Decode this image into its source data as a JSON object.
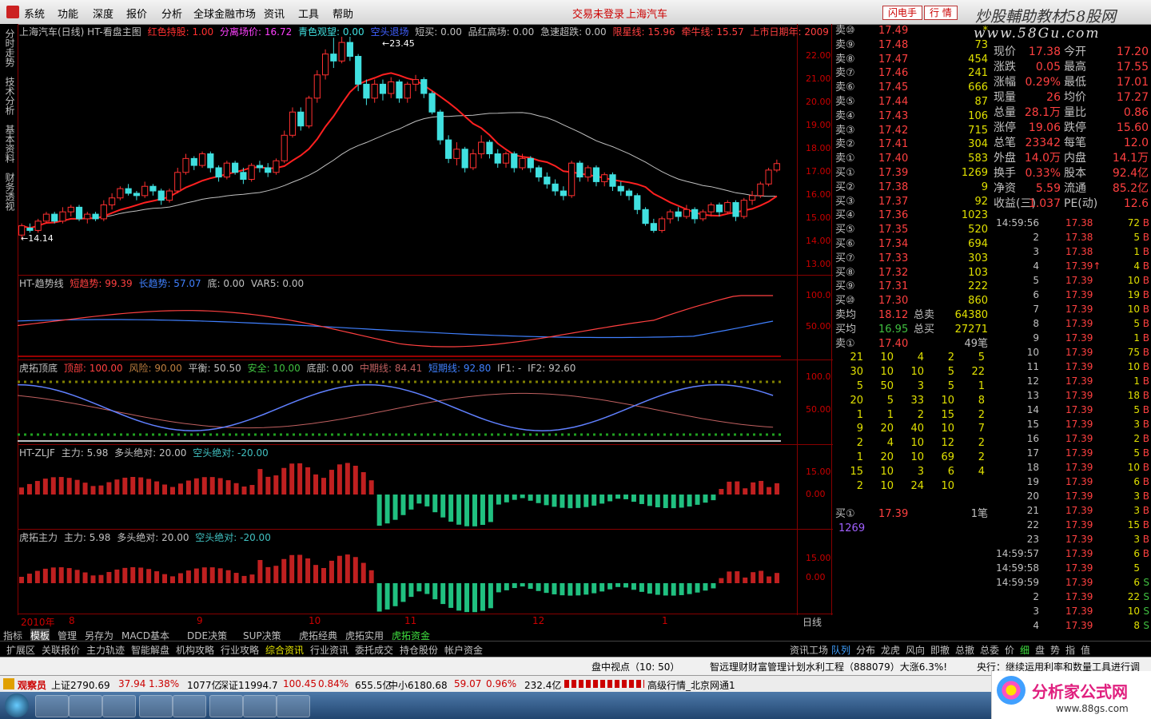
{
  "menu": [
    "系统",
    "功能",
    "深度",
    "报价",
    "分析",
    "全球金融市场",
    "资讯",
    "工具",
    "帮助"
  ],
  "header": {
    "login_status": "交易未登录",
    "stock_title": "上海汽车",
    "btn_flash": "闪电手",
    "btn_quote": "行 情"
  },
  "watermark": {
    "line1": "炒股輔助教材58股网",
    "line2": "www.58Gu.com"
  },
  "left_tabs": [
    "分时走势",
    "技术分析",
    "基本资料",
    "财务透视"
  ],
  "main_chart": {
    "title": "上海汽车(日线) HT-看盘主图",
    "legend": [
      {
        "label": "红色持股: 1.00",
        "color": "#ff3030"
      },
      {
        "label": "分离场价: 16.72",
        "color": "#ff40ff"
      },
      {
        "label": "青色观望: 0.00",
        "color": "#40e0e0"
      },
      {
        "label": "空头退场",
        "color": "#4060ff"
      },
      {
        "label": "短买: 0.00",
        "color": "#c0c0c0"
      },
      {
        "label": "品红高场: 0.00",
        "color": "#c0c0c0"
      },
      {
        "label": "急速超跌: 0.00",
        "color": "#c0c0c0"
      },
      {
        "label": "限星线: 15.96",
        "color": "#ff4040"
      },
      {
        "label": "牵牛线: 15.57",
        "color": "#ff4040"
      },
      {
        "label": "上市日期年: 2009",
        "color": "#ff4040"
      }
    ],
    "y_ticks": [
      "22.00",
      "21.00",
      "20.00",
      "19.00",
      "18.00",
      "17.00",
      "16.00",
      "15.00",
      "14.00",
      "13.00"
    ],
    "annotations": {
      "low": "14.14",
      "high": "23.45"
    }
  },
  "chart_data": {
    "type": "candlestick",
    "ylim": [
      13,
      22.5
    ],
    "candles": [
      {
        "o": 14.3,
        "c": 14.7,
        "h": 14.8,
        "l": 14.1
      },
      {
        "o": 14.6,
        "c": 14.5,
        "h": 14.8,
        "l": 14.4
      },
      {
        "o": 14.5,
        "c": 14.9,
        "h": 15.0,
        "l": 14.4
      },
      {
        "o": 14.9,
        "c": 15.2,
        "h": 15.3,
        "l": 14.8
      },
      {
        "o": 15.2,
        "c": 14.9,
        "h": 15.3,
        "l": 14.8
      },
      {
        "o": 14.9,
        "c": 15.3,
        "h": 15.5,
        "l": 14.8
      },
      {
        "o": 15.3,
        "c": 15.5,
        "h": 15.6,
        "l": 15.1
      },
      {
        "o": 15.5,
        "c": 15.0,
        "h": 15.6,
        "l": 14.9
      },
      {
        "o": 15.0,
        "c": 15.2,
        "h": 15.3,
        "l": 14.8
      },
      {
        "o": 15.2,
        "c": 15.0,
        "h": 15.3,
        "l": 14.9
      },
      {
        "o": 15.0,
        "c": 15.6,
        "h": 15.8,
        "l": 14.9
      },
      {
        "o": 15.6,
        "c": 15.9,
        "h": 16.1,
        "l": 15.4
      },
      {
        "o": 15.9,
        "c": 16.3,
        "h": 16.4,
        "l": 15.8
      },
      {
        "o": 16.3,
        "c": 16.1,
        "h": 16.5,
        "l": 16.0
      },
      {
        "o": 16.1,
        "c": 16.0,
        "h": 16.2,
        "l": 15.8
      },
      {
        "o": 16.0,
        "c": 16.4,
        "h": 16.6,
        "l": 15.9
      },
      {
        "o": 16.4,
        "c": 16.2,
        "h": 16.5,
        "l": 16.0
      },
      {
        "o": 16.2,
        "c": 15.8,
        "h": 16.3,
        "l": 15.6
      },
      {
        "o": 15.8,
        "c": 16.2,
        "h": 16.3,
        "l": 15.7
      },
      {
        "o": 16.2,
        "c": 17.0,
        "h": 17.2,
        "l": 16.1
      },
      {
        "o": 17.0,
        "c": 17.6,
        "h": 17.8,
        "l": 16.9
      },
      {
        "o": 17.6,
        "c": 17.3,
        "h": 17.7,
        "l": 17.1
      },
      {
        "o": 17.3,
        "c": 17.8,
        "h": 17.9,
        "l": 17.2
      },
      {
        "o": 17.8,
        "c": 17.2,
        "h": 17.9,
        "l": 17.0
      },
      {
        "o": 17.2,
        "c": 16.8,
        "h": 17.3,
        "l": 16.6
      },
      {
        "o": 16.8,
        "c": 17.4,
        "h": 17.5,
        "l": 16.7
      },
      {
        "o": 17.4,
        "c": 17.0,
        "h": 17.5,
        "l": 16.9
      },
      {
        "o": 17.0,
        "c": 16.7,
        "h": 17.2,
        "l": 16.5
      },
      {
        "o": 16.7,
        "c": 17.3,
        "h": 17.4,
        "l": 16.6
      },
      {
        "o": 17.3,
        "c": 17.2,
        "h": 17.5,
        "l": 17.0
      },
      {
        "o": 17.2,
        "c": 17.0,
        "h": 17.4,
        "l": 16.8
      },
      {
        "o": 17.0,
        "c": 17.5,
        "h": 17.6,
        "l": 16.9
      },
      {
        "o": 17.5,
        "c": 18.6,
        "h": 18.8,
        "l": 17.4
      },
      {
        "o": 18.6,
        "c": 19.6,
        "h": 19.8,
        "l": 18.5
      },
      {
        "o": 19.6,
        "c": 19.0,
        "h": 19.8,
        "l": 18.8
      },
      {
        "o": 19.0,
        "c": 20.2,
        "h": 20.3,
        "l": 18.9
      },
      {
        "o": 20.2,
        "c": 21.2,
        "h": 21.4,
        "l": 20.0
      },
      {
        "o": 21.2,
        "c": 22.1,
        "h": 22.3,
        "l": 21.0
      },
      {
        "o": 22.1,
        "c": 21.8,
        "h": 22.8,
        "l": 21.5
      },
      {
        "o": 21.8,
        "c": 22.6,
        "h": 23.45,
        "l": 21.7
      },
      {
        "o": 22.6,
        "c": 22.0,
        "h": 23.0,
        "l": 21.8
      },
      {
        "o": 22.0,
        "c": 20.8,
        "h": 22.1,
        "l": 20.5
      },
      {
        "o": 20.8,
        "c": 20.2,
        "h": 21.0,
        "l": 19.9
      },
      {
        "o": 20.2,
        "c": 20.8,
        "h": 21.0,
        "l": 20.0
      },
      {
        "o": 20.8,
        "c": 20.4,
        "h": 21.0,
        "l": 20.1
      },
      {
        "o": 20.4,
        "c": 20.9,
        "h": 21.1,
        "l": 20.2
      },
      {
        "o": 20.9,
        "c": 20.2,
        "h": 21.0,
        "l": 20.0
      },
      {
        "o": 20.2,
        "c": 20.8,
        "h": 20.9,
        "l": 20.0
      },
      {
        "o": 20.8,
        "c": 21.0,
        "h": 21.2,
        "l": 20.5
      },
      {
        "o": 21.0,
        "c": 20.4,
        "h": 21.1,
        "l": 20.2
      },
      {
        "o": 20.4,
        "c": 19.6,
        "h": 20.5,
        "l": 19.5
      },
      {
        "o": 19.6,
        "c": 18.4,
        "h": 19.7,
        "l": 18.2
      },
      {
        "o": 18.4,
        "c": 17.6,
        "h": 18.6,
        "l": 17.4
      },
      {
        "o": 17.6,
        "c": 18.0,
        "h": 18.3,
        "l": 17.3
      },
      {
        "o": 18.0,
        "c": 17.2,
        "h": 18.1,
        "l": 17.0
      },
      {
        "o": 17.2,
        "c": 17.8,
        "h": 18.0,
        "l": 17.1
      },
      {
        "o": 17.8,
        "c": 18.3,
        "h": 18.6,
        "l": 17.6
      },
      {
        "o": 18.3,
        "c": 17.8,
        "h": 18.4,
        "l": 17.6
      },
      {
        "o": 17.8,
        "c": 17.4,
        "h": 18.0,
        "l": 17.2
      },
      {
        "o": 17.4,
        "c": 17.8,
        "h": 17.9,
        "l": 17.2
      },
      {
        "o": 17.8,
        "c": 17.2,
        "h": 17.9,
        "l": 17.0
      },
      {
        "o": 17.2,
        "c": 17.6,
        "h": 17.8,
        "l": 17.1
      },
      {
        "o": 17.6,
        "c": 17.2,
        "h": 17.7,
        "l": 17.0
      },
      {
        "o": 17.2,
        "c": 16.8,
        "h": 17.3,
        "l": 16.6
      },
      {
        "o": 16.8,
        "c": 16.5,
        "h": 17.0,
        "l": 16.3
      },
      {
        "o": 16.5,
        "c": 16.2,
        "h": 16.7,
        "l": 16.0
      },
      {
        "o": 16.2,
        "c": 16.0,
        "h": 16.4,
        "l": 15.8
      },
      {
        "o": 16.0,
        "c": 17.4,
        "h": 17.5,
        "l": 15.9
      },
      {
        "o": 17.4,
        "c": 16.8,
        "h": 17.5,
        "l": 16.6
      },
      {
        "o": 16.8,
        "c": 17.2,
        "h": 17.3,
        "l": 16.6
      },
      {
        "o": 17.2,
        "c": 16.6,
        "h": 17.3,
        "l": 16.4
      },
      {
        "o": 16.6,
        "c": 16.9,
        "h": 17.0,
        "l": 16.4
      },
      {
        "o": 16.9,
        "c": 16.4,
        "h": 17.0,
        "l": 16.2
      },
      {
        "o": 16.4,
        "c": 16.2,
        "h": 16.6,
        "l": 16.0
      },
      {
        "o": 16.2,
        "c": 16.0,
        "h": 16.3,
        "l": 15.8
      },
      {
        "o": 16.0,
        "c": 15.4,
        "h": 16.1,
        "l": 15.2
      },
      {
        "o": 15.4,
        "c": 14.8,
        "h": 15.5,
        "l": 14.7
      },
      {
        "o": 14.8,
        "c": 14.5,
        "h": 15.0,
        "l": 14.4
      },
      {
        "o": 14.5,
        "c": 15.0,
        "h": 15.1,
        "l": 14.4
      },
      {
        "o": 15.0,
        "c": 15.3,
        "h": 15.4,
        "l": 14.8
      },
      {
        "o": 15.3,
        "c": 15.1,
        "h": 15.5,
        "l": 14.9
      },
      {
        "o": 15.1,
        "c": 15.4,
        "h": 15.6,
        "l": 15.0
      },
      {
        "o": 15.4,
        "c": 15.0,
        "h": 15.5,
        "l": 14.8
      },
      {
        "o": 15.0,
        "c": 15.3,
        "h": 15.4,
        "l": 14.9
      },
      {
        "o": 15.3,
        "c": 15.6,
        "h": 15.7,
        "l": 15.1
      },
      {
        "o": 15.6,
        "c": 15.3,
        "h": 15.7,
        "l": 15.1
      },
      {
        "o": 15.3,
        "c": 15.7,
        "h": 15.8,
        "l": 15.2
      },
      {
        "o": 15.7,
        "c": 15.1,
        "h": 15.8,
        "l": 14.9
      },
      {
        "o": 15.1,
        "c": 15.8,
        "h": 15.9,
        "l": 15.0
      },
      {
        "o": 15.8,
        "c": 16.0,
        "h": 16.2,
        "l": 15.6
      },
      {
        "o": 16.0,
        "c": 16.5,
        "h": 16.6,
        "l": 15.9
      },
      {
        "o": 16.5,
        "c": 17.1,
        "h": 17.2,
        "l": 16.4
      },
      {
        "o": 17.1,
        "c": 17.38,
        "h": 17.55,
        "l": 17.01
      }
    ]
  },
  "sub1": {
    "title": "HT-趋势线",
    "items": [
      {
        "label": "短趋势: 99.39",
        "color": "#ff4040"
      },
      {
        "label": "长趋势: 57.07",
        "color": "#4080ff"
      },
      {
        "label": "底: 0.00",
        "color": "#c0c0c0"
      },
      {
        "label": "VAR5: 0.00",
        "color": "#c0c0c0"
      }
    ],
    "y_ticks": [
      "100.0",
      "50.00"
    ]
  },
  "sub2": {
    "title": "虎拓顶底",
    "items": [
      {
        "label": "顶部: 100.00",
        "color": "#ff4040"
      },
      {
        "label": "风险: 90.00",
        "color": "#c08040"
      },
      {
        "label": "平衡: 50.50",
        "color": "#c0c0c0"
      },
      {
        "label": "安全: 10.00",
        "color": "#40c040"
      },
      {
        "label": "底部: 0.00",
        "color": "#c0c0c0"
      },
      {
        "label": "中期线: 84.41",
        "color": "#c06060"
      },
      {
        "label": "短期线: 92.80",
        "color": "#4080ff"
      },
      {
        "label": "IF1: -",
        "color": "#c0c0c0"
      },
      {
        "label": "IF2: 92.60",
        "color": "#c0c0c0"
      }
    ],
    "y_ticks": [
      "100.0",
      "50.00"
    ]
  },
  "sub3": {
    "title": "HT-ZLJF",
    "items": [
      {
        "label": "主力: 5.98",
        "color": "#c0c0c0"
      },
      {
        "label": "多头绝对: 20.00",
        "color": "#c0c0c0"
      },
      {
        "label": "空头绝对: -20.00",
        "color": "#40c0c0"
      }
    ],
    "y_ticks": [
      "15.00",
      "0.00"
    ]
  },
  "sub4": {
    "title": "虎拓主力",
    "items": [
      {
        "label": "主力: 5.98",
        "color": "#c0c0c0"
      },
      {
        "label": "多头绝对: 20.00",
        "color": "#c0c0c0"
      },
      {
        "label": "空头绝对: -20.00",
        "color": "#40c0c0"
      }
    ],
    "y_ticks": [
      "15.00",
      "0.00"
    ]
  },
  "x_axis": {
    "year": "2010年",
    "months": [
      "8",
      "9",
      "10",
      "11",
      "12",
      "1"
    ],
    "period": "日线"
  },
  "orderbook": {
    "sells": [
      {
        "label": "卖⑩",
        "price": "17.49",
        "vol": "*"
      },
      {
        "label": "卖⑨",
        "price": "17.48",
        "vol": "73"
      },
      {
        "label": "卖⑧",
        "price": "17.47",
        "vol": "454"
      },
      {
        "label": "卖⑦",
        "price": "17.46",
        "vol": "241"
      },
      {
        "label": "卖⑥",
        "price": "17.45",
        "vol": "666"
      },
      {
        "label": "卖⑤",
        "price": "17.44",
        "vol": "87"
      },
      {
        "label": "卖④",
        "price": "17.43",
        "vol": "106"
      },
      {
        "label": "卖③",
        "price": "17.42",
        "vol": "715"
      },
      {
        "label": "卖②",
        "price": "17.41",
        "vol": "304"
      },
      {
        "label": "卖①",
        "price": "17.40",
        "vol": "583"
      }
    ],
    "buys": [
      {
        "label": "买①",
        "price": "17.39",
        "vol": "1269"
      },
      {
        "label": "买②",
        "price": "17.38",
        "vol": "9"
      },
      {
        "label": "买③",
        "price": "17.37",
        "vol": "92"
      },
      {
        "label": "买④",
        "price": "17.36",
        "vol": "1023"
      },
      {
        "label": "买⑤",
        "price": "17.35",
        "vol": "520"
      },
      {
        "label": "买⑥",
        "price": "17.34",
        "vol": "694"
      },
      {
        "label": "买⑦",
        "price": "17.33",
        "vol": "303"
      },
      {
        "label": "买⑧",
        "price": "17.32",
        "vol": "103"
      },
      {
        "label": "买⑨",
        "price": "17.31",
        "vol": "222"
      },
      {
        "label": "买⑩",
        "price": "17.30",
        "vol": "860"
      }
    ],
    "avg_sell": {
      "label": "卖均",
      "price": "18.12",
      "tlabel": "总卖",
      "total": "64380"
    },
    "avg_buy": {
      "label": "买均",
      "price": "16.95",
      "tlabel": "总买",
      "total": "27271"
    },
    "queue_sell": {
      "label": "卖①",
      "price": "17.40",
      "count": "49笔"
    },
    "queue_grid": [
      [
        "21",
        "10",
        "4",
        "2",
        "5"
      ],
      [
        "30",
        "10",
        "10",
        "5",
        "22"
      ],
      [
        "5",
        "50",
        "3",
        "5",
        "1"
      ],
      [
        "20",
        "5",
        "33",
        "10",
        "8"
      ],
      [
        "1",
        "1",
        "2",
        "15",
        "2"
      ],
      [
        "9",
        "20",
        "40",
        "10",
        "7"
      ],
      [
        "2",
        "4",
        "10",
        "12",
        "2"
      ],
      [
        "1",
        "20",
        "10",
        "69",
        "2"
      ],
      [
        "15",
        "10",
        "3",
        "6",
        "4"
      ],
      [
        "2",
        "10",
        "24",
        "10",
        ""
      ]
    ],
    "queue_buy": {
      "label": "买①",
      "price": "17.39",
      "count": "1笔",
      "vol": "1269"
    }
  },
  "quote": [
    [
      "现价",
      "17.38",
      "今开",
      "17.20"
    ],
    [
      "涨跌",
      "0.05",
      "最高",
      "17.55"
    ],
    [
      "涨幅",
      "0.29%",
      "最低",
      "17.01"
    ],
    [
      "现量",
      "26",
      "均价",
      "17.27"
    ],
    [
      "总量",
      "28.1万",
      "量比",
      "0.86"
    ],
    [
      "涨停",
      "19.06",
      "跌停",
      "15.60"
    ],
    [
      "总笔",
      "23342",
      "每笔",
      "12.0"
    ],
    [
      "外盘",
      "14.0万",
      "内盘",
      "14.1万"
    ],
    [
      "换手",
      "0.33%",
      "股本",
      "92.4亿"
    ],
    [
      "净资",
      "5.59",
      "流通",
      "85.2亿"
    ],
    [
      "收益(三)",
      "1.037",
      "PE(动)",
      "12.6"
    ]
  ],
  "ticks": [
    [
      "14:59:56",
      "17.38",
      "72",
      "B"
    ],
    [
      "2",
      "17.38",
      "5",
      "B"
    ],
    [
      "3",
      "17.38",
      "1",
      "B"
    ],
    [
      "4",
      "17.39↑",
      "4",
      "B"
    ],
    [
      "5",
      "17.39",
      "10",
      "B"
    ],
    [
      "6",
      "17.39",
      "19",
      "B"
    ],
    [
      "7",
      "17.39",
      "10",
      "B"
    ],
    [
      "8",
      "17.39",
      "5",
      "B"
    ],
    [
      "9",
      "17.39",
      "1",
      "B"
    ],
    [
      "10",
      "17.39",
      "75",
      "B"
    ],
    [
      "11",
      "17.39",
      "10",
      "B"
    ],
    [
      "12",
      "17.39",
      "1",
      "B"
    ],
    [
      "13",
      "17.39",
      "18",
      "B"
    ],
    [
      "14",
      "17.39",
      "5",
      "B"
    ],
    [
      "15",
      "17.39",
      "3",
      "B"
    ],
    [
      "16",
      "17.39",
      "2",
      "B"
    ],
    [
      "17",
      "17.39",
      "5",
      "B"
    ],
    [
      "18",
      "17.39",
      "10",
      "B"
    ],
    [
      "19",
      "17.39",
      "6",
      "B"
    ],
    [
      "20",
      "17.39",
      "3",
      "B"
    ],
    [
      "21",
      "17.39",
      "3",
      "B"
    ],
    [
      "22",
      "17.39",
      "15",
      "B"
    ],
    [
      "23",
      "17.39",
      "3",
      "B"
    ],
    [
      "14:59:57",
      "17.39",
      "6",
      "B"
    ],
    [
      "14:59:58",
      "17.39",
      "5",
      ""
    ],
    [
      "14:59:59",
      "17.39",
      "6",
      "S"
    ],
    [
      "2",
      "17.39",
      "22",
      "S"
    ],
    [
      "3",
      "17.39",
      "10",
      "S"
    ],
    [
      "4",
      "17.39",
      "8",
      "S"
    ]
  ],
  "bottom_tabs": [
    "指标",
    "模板",
    "管理",
    "另存为",
    "MACD基本",
    "DDE决策",
    "SUP决策",
    "虎拓经典",
    "虎拓实用",
    "虎拓资金"
  ],
  "row2_left": [
    "扩展区",
    "关联报价",
    "主力轨迹",
    "智能解盘",
    "机构攻略",
    "行业攻略",
    "综合资讯",
    "行业资讯",
    "委托成交",
    "持仓股份",
    "帐户资金"
  ],
  "row2_right": [
    "资讯工场",
    "队列",
    "分布",
    "龙虎",
    "风向",
    "即撤",
    "总撤",
    "总委",
    "价",
    "细",
    "盘",
    "势",
    "指",
    "值"
  ],
  "news": {
    "time": "盘中视点（10: 50）",
    "headline": "智远理财财富管理计划水利工程（888079）大涨6.3%!",
    "right": "央行：继续运用利率和数量工具进行调"
  },
  "status": {
    "mode": "观察员",
    "sh": "上证2790.69",
    "sh_chg": "37.94",
    "sh_pct": "1.38%",
    "sh_amt": "1077亿",
    "sz": "深证11994.7",
    "sz_chg": "100.45",
    "sz_pct": "0.84%",
    "sz_amt": "655.5亿",
    "zx": "中小6180.68",
    "zx_chg": "59.07",
    "zx_pct": "0.96%",
    "zx_amt": "232.4亿",
    "feed": "高级行情_北京网通1"
  },
  "logo": {
    "text": "分析家公式网",
    "url": "www.88gs.com"
  }
}
